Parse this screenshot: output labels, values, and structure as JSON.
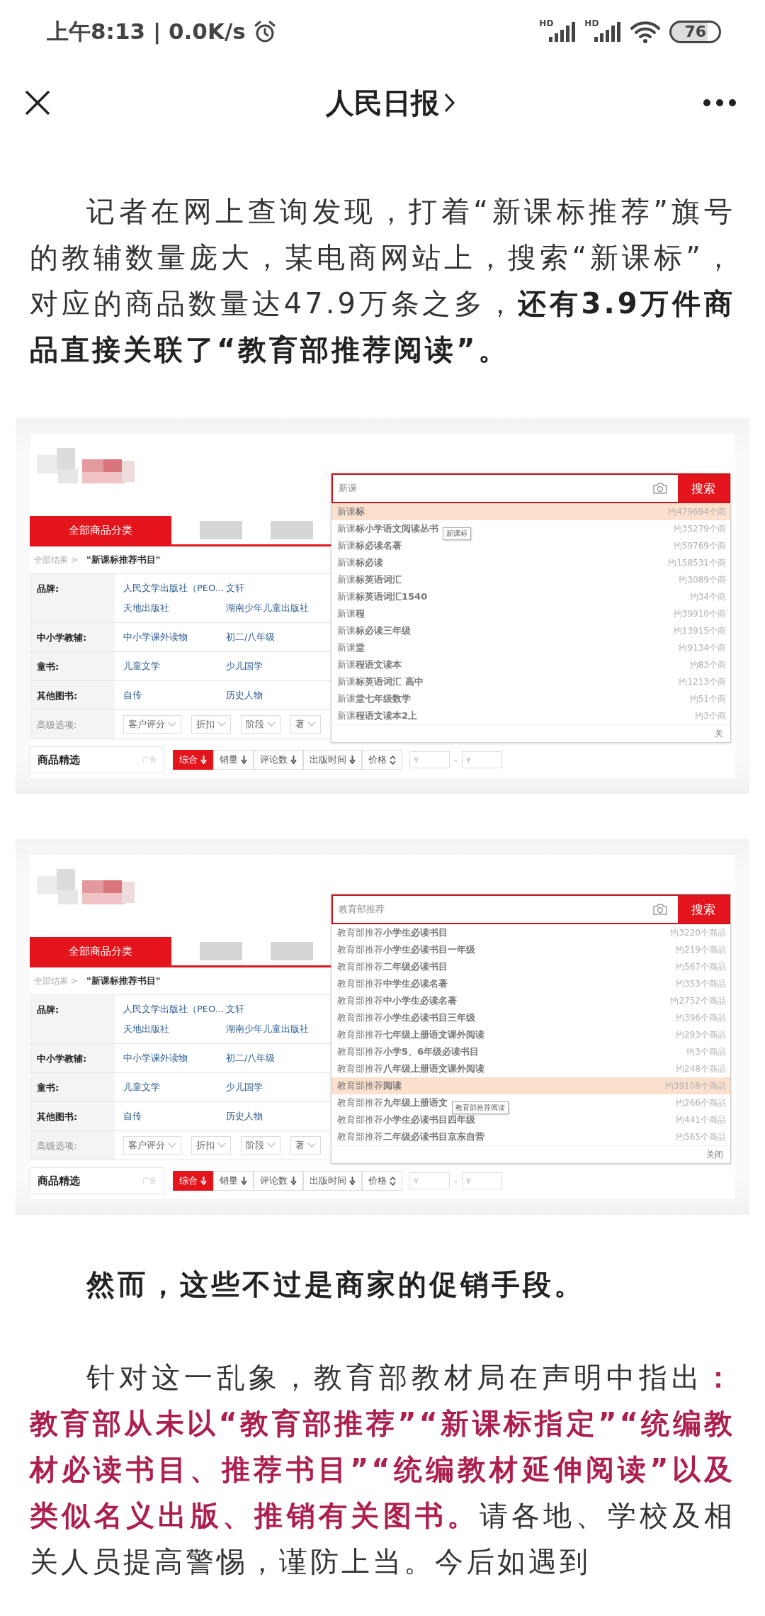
{
  "status_bar": {
    "time": "上午8:13 | 0.0K/s",
    "signals": [
      {
        "label": "HD"
      },
      {
        "label": "HD"
      }
    ],
    "battery": "76"
  },
  "nav": {
    "title": "人民日报"
  },
  "article": {
    "blocks": [
      {
        "kind": "paragraph",
        "segments": [
          {
            "text": "记者在网上查询发现，打着“新课标推荐”旗号的教辅数量庞大，某电商网站上，搜索“新课标”，对应的商品数量达47.9万条之多，",
            "kind": "plain"
          },
          {
            "text": "还有3.9万件商品直接关联了“教育部推荐阅读”。",
            "kind": "bold"
          }
        ]
      },
      {
        "kind": "screenshot",
        "category_tab": "全部商品分类",
        "breadcrumb": {
          "root": "全部结果 >",
          "query": "\"新课标推荐书目\""
        },
        "filters": [
          {
            "label": "品牌:",
            "values": [
              "人民文学出版社（PEO...",
              "文轩",
              "天地出版社",
              "湖南少年儿童出版社"
            ]
          },
          {
            "label": "中小学教辅:",
            "values": [
              "中小学课外读物",
              "初二/八年级"
            ]
          },
          {
            "label": "童书:",
            "values": [
              "儿童文学",
              "少儿国学"
            ]
          },
          {
            "label": "其他图书:",
            "values": [
              "自传",
              "历史人物"
            ]
          }
        ],
        "advanced": {
          "label": "高级选项:",
          "options": [
            "客户评分",
            "折扣",
            "阶段",
            "著"
          ]
        },
        "featured": {
          "title": "商品精选",
          "tag": "广告"
        },
        "sort": [
          {
            "label": "综合",
            "kind": "down",
            "selected": true
          },
          {
            "label": "销量",
            "kind": "down",
            "selected": false
          },
          {
            "label": "评论数",
            "kind": "down",
            "selected": false
          },
          {
            "label": "出版时间",
            "kind": "down",
            "selected": false
          },
          {
            "label": "价格",
            "kind": "both",
            "selected": false
          }
        ],
        "price_range": {
          "from": "¥",
          "separator": "-",
          "to": "¥"
        },
        "search": {
          "query": "新课",
          "button": "搜索"
        },
        "suggestions": [
          {
            "text": "新课**标**",
            "count": "约479694个商",
            "selected": true
          },
          {
            "text": "新课**标小学语文阅读丛书**",
            "count": "约35279个商",
            "selected": false,
            "tooltip": "新课标"
          },
          {
            "text": "新课**标必读名著**",
            "count": "约59769个商",
            "selected": false
          },
          {
            "text": "新课**标必读**",
            "count": "约158531个商",
            "selected": false
          },
          {
            "text": "新课**标英语词汇**",
            "count": "约3089个商",
            "selected": false
          },
          {
            "text": "新课**标英语词汇1540**",
            "count": "约34个商",
            "selected": false
          },
          {
            "text": "新课**程**",
            "count": "约39910个商",
            "selected": false
          },
          {
            "text": "新课**标必读三年级**",
            "count": "约13915个商",
            "selected": false
          },
          {
            "text": "新课**堂**",
            "count": "约9134个商",
            "selected": false
          },
          {
            "text": "新课**程语文读本**",
            "count": "约83个商",
            "selected": false
          },
          {
            "text": "新课**标英语词汇 高中**",
            "count": "约1213个商",
            "selected": false
          },
          {
            "text": "新课**堂七年级数学**",
            "count": "约51个商",
            "selected": false
          },
          {
            "text": "新课**程语文读本2上**",
            "count": "约3个商",
            "selected": false
          }
        ],
        "close": "关"
      },
      {
        "kind": "screenshot",
        "category_tab": "全部商品分类",
        "breadcrumb": {
          "root": "全部结果 >",
          "query": "\"新课标推荐书目\""
        },
        "filters": [
          {
            "label": "品牌:",
            "values": [
              "人民文学出版社（PEO...",
              "文轩",
              "天地出版社",
              "湖南少年儿童出版社"
            ]
          },
          {
            "label": "中小学教辅:",
            "values": [
              "中小学课外读物",
              "初二/八年级"
            ]
          },
          {
            "label": "童书:",
            "values": [
              "儿童文学",
              "少儿国学"
            ]
          },
          {
            "label": "其他图书:",
            "values": [
              "自传",
              "历史人物"
            ]
          }
        ],
        "advanced": {
          "label": "高级选项:",
          "options": [
            "客户评分",
            "折扣",
            "阶段",
            "著"
          ]
        },
        "featured": {
          "title": "商品精选",
          "tag": "广告"
        },
        "sort": [
          {
            "label": "综合",
            "kind": "down",
            "selected": true
          },
          {
            "label": "销量",
            "kind": "down",
            "selected": false
          },
          {
            "label": "评论数",
            "kind": "down",
            "selected": false
          },
          {
            "label": "出版时间",
            "kind": "down",
            "selected": false
          },
          {
            "label": "价格",
            "kind": "both",
            "selected": false
          }
        ],
        "price_range": {
          "from": "¥",
          "separator": "-",
          "to": "¥"
        },
        "search": {
          "query": "教育部推荐",
          "button": "搜索"
        },
        "suggestions": [
          {
            "text": "教育部推荐**小学生必读书目**",
            "count": "约3220个商品",
            "selected": false
          },
          {
            "text": "教育部推荐**小学生必读书目一年级**",
            "count": "约219个商品",
            "selected": false
          },
          {
            "text": "教育部推荐**二年级必读书目**",
            "count": "约567个商品",
            "selected": false
          },
          {
            "text": "教育部推荐**中学生必读名著**",
            "count": "约353个商品",
            "selected": false
          },
          {
            "text": "教育部推荐**中小学生必读名著**",
            "count": "约2752个商品",
            "selected": false
          },
          {
            "text": "教育部推荐**小学生必读书目三年级**",
            "count": "约396个商品",
            "selected": false
          },
          {
            "text": "教育部推荐**七年级上册语文课外阅读**",
            "count": "约293个商品",
            "selected": false
          },
          {
            "text": "教育部推荐**小学5、6年级必读书目**",
            "count": "约3个商品",
            "selected": false
          },
          {
            "text": "教育部推荐**八年级上册语文课外阅读**",
            "count": "约248个商品",
            "selected": false
          },
          {
            "text": "教育部推荐**阅读**",
            "count": "约39108个商品",
            "selected": true
          },
          {
            "text": "教育部推荐**九年级上册语文**",
            "count": "约266个商品",
            "selected": false,
            "tooltip": "教育部推荐阅读"
          },
          {
            "text": "教育部推荐**小学生必读书目四年级**",
            "count": "约441个商品",
            "selected": false
          },
          {
            "text": "教育部推荐**二年级必读书目京东自营**",
            "count": "约565个商品",
            "selected": false
          }
        ],
        "close": "关闭"
      },
      {
        "kind": "paragraph",
        "segments": [
          {
            "text": "然而，这些不过是商家的促销手段。",
            "kind": "bold"
          }
        ]
      },
      {
        "kind": "paragraph",
        "segments": [
          {
            "text": "针对这一乱象，教育部教材局在声明中指出",
            "kind": "plain"
          },
          {
            "text": "：教育部从未以“教育部推荐”“新课标指定”“统编教材必读书目、推荐书目”“统编教材延伸阅读”以及类似名义出版、推销有关图书。",
            "kind": "red-bold"
          },
          {
            "text": "请各地、学校及相关人员提高警惕，谨防上当。今后如遇到",
            "kind": "plain"
          }
        ]
      }
    ]
  }
}
